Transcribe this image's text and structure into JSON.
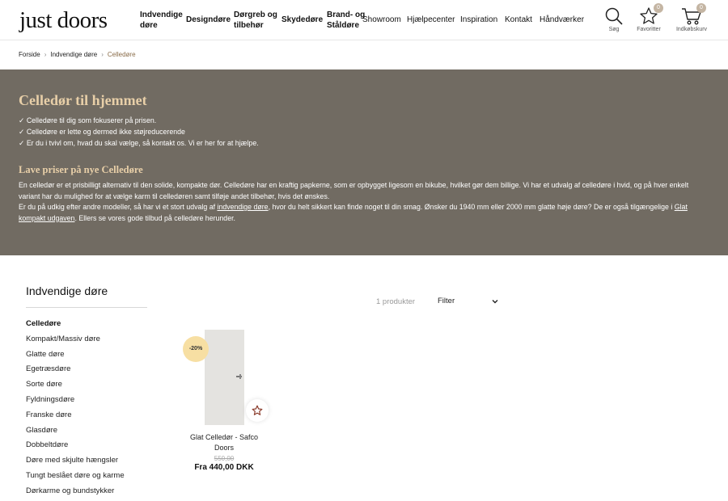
{
  "header": {
    "logo": "just doors",
    "nav": [
      {
        "line1": "Indvendige",
        "line2": "døre"
      },
      {
        "line1": "Designdøre",
        "line2": ""
      },
      {
        "line1": "Dørgreb og",
        "line2": "tilbehør"
      },
      {
        "line1": "Skydedøre",
        "line2": ""
      },
      {
        "line1": "Brand- og",
        "line2": "Ståldøre"
      }
    ],
    "nav_plain": [
      "Showroom",
      "Hjælpecenter",
      "Inspiration",
      "Kontakt",
      "Håndværker"
    ],
    "icons": {
      "search": {
        "label": "Søg",
        "icon": "search-icon"
      },
      "favorites": {
        "label": "Favoritter",
        "icon": "star-icon",
        "count": "0"
      },
      "cart": {
        "label": "Indkøbskurv",
        "icon": "cart-icon",
        "count": "0"
      }
    }
  },
  "breadcrumb": {
    "items": [
      "Forside",
      "Indvendige døre"
    ],
    "current": "Celledøre"
  },
  "hero": {
    "title": "Celledør til hjemmet",
    "checks": [
      "✓ Celledøre til dig som fokuserer på prisen.",
      "✓ Celledøre er lette og dermed ikke støjreducerende",
      "✓ Er du i tvivl om, hvad du skal vælge, så kontakt os. Vi er her for at hjælpe."
    ],
    "subtitle": "Lave priser på nye Celledøre",
    "paragraph1": "En celledør er et prisbilligt alternativ til den solide, kompakte dør. Celledøre har en kraftig papkerne, som er opbygget ligesom en bikube, hvilket gør dem billige. Vi har et udvalg af celledøre i hvid, og på hver enkelt variant har du mulighed for at vælge karm til celledøren samt tilføje andet tilbehør, hvis det ønskes.",
    "p2_a": "Er du på udkig efter andre modeller, så har vi et stort udvalg af ",
    "p2_link1": "indvendige døre",
    "p2_b": ", hvor du helt sikkert kan finde noget til din smag. Ønsker du 1940 mm eller 2000 mm glatte høje døre? De er også tilgængelige i ",
    "p2_link2": "Glat kompakt udgaven",
    "p2_c": ". Ellers se vores gode tilbud på celledøre herunder."
  },
  "sidebar": {
    "title": "Indvendige døre",
    "items": [
      "Celledøre",
      "Kompakt/Massiv døre",
      "Glatte døre",
      "Egetræsdøre",
      "Sorte døre",
      "Fyldningsdøre",
      "Franske døre",
      "Glasdøre",
      "Dobbeltdøre",
      "Døre med skjulte hængsler",
      "Tungt beslået døre og karme",
      "Dørkarme og bundstykker"
    ]
  },
  "toolbar": {
    "count": "1 produkter",
    "filter_label": "Filter"
  },
  "product": {
    "badge": "-20%",
    "name": "Glat Celledør - Safco Doors",
    "old_price": "550,00",
    "price": "Fra 440,00 DKK"
  },
  "colors": {
    "hero_bg": "#716b62",
    "hero_heading": "#e8cfa8",
    "badge_bg": "#f7dfa3",
    "breadcrumb_current": "#8a6d4a"
  }
}
